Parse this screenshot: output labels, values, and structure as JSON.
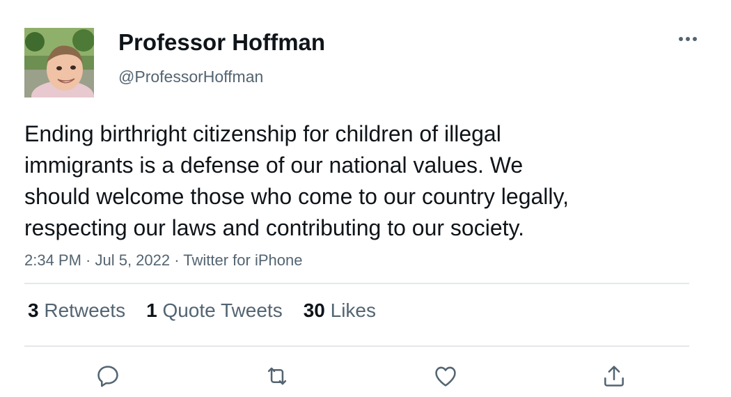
{
  "author": {
    "name": "Professor Hoffman",
    "handle": "@ProfessorHoffman"
  },
  "tweet": {
    "lines": [
      "Ending birthright citizenship for children of illegal",
      "immigrants is a defense of our national values. We",
      "should welcome those who come to our country legally,",
      "respecting our laws and contributing to our society."
    ],
    "meta": "2:34 PM · Jul 5, 2022 · Twitter for iPhone"
  },
  "stats": {
    "retweets_count": "3",
    "retweets_label": "Retweets",
    "quotes_count": "1",
    "quotes_label": "Quote Tweets",
    "likes_count": "30",
    "likes_label": "Likes"
  },
  "icons": {
    "more": "more-dots-icon",
    "reply": "reply-bubble-icon",
    "retweet": "retweet-icon",
    "like": "heart-icon",
    "share": "share-upload-icon"
  },
  "colors": {
    "text": "#0f1419",
    "secondary": "#536471",
    "divider": "#e4e7ea"
  }
}
